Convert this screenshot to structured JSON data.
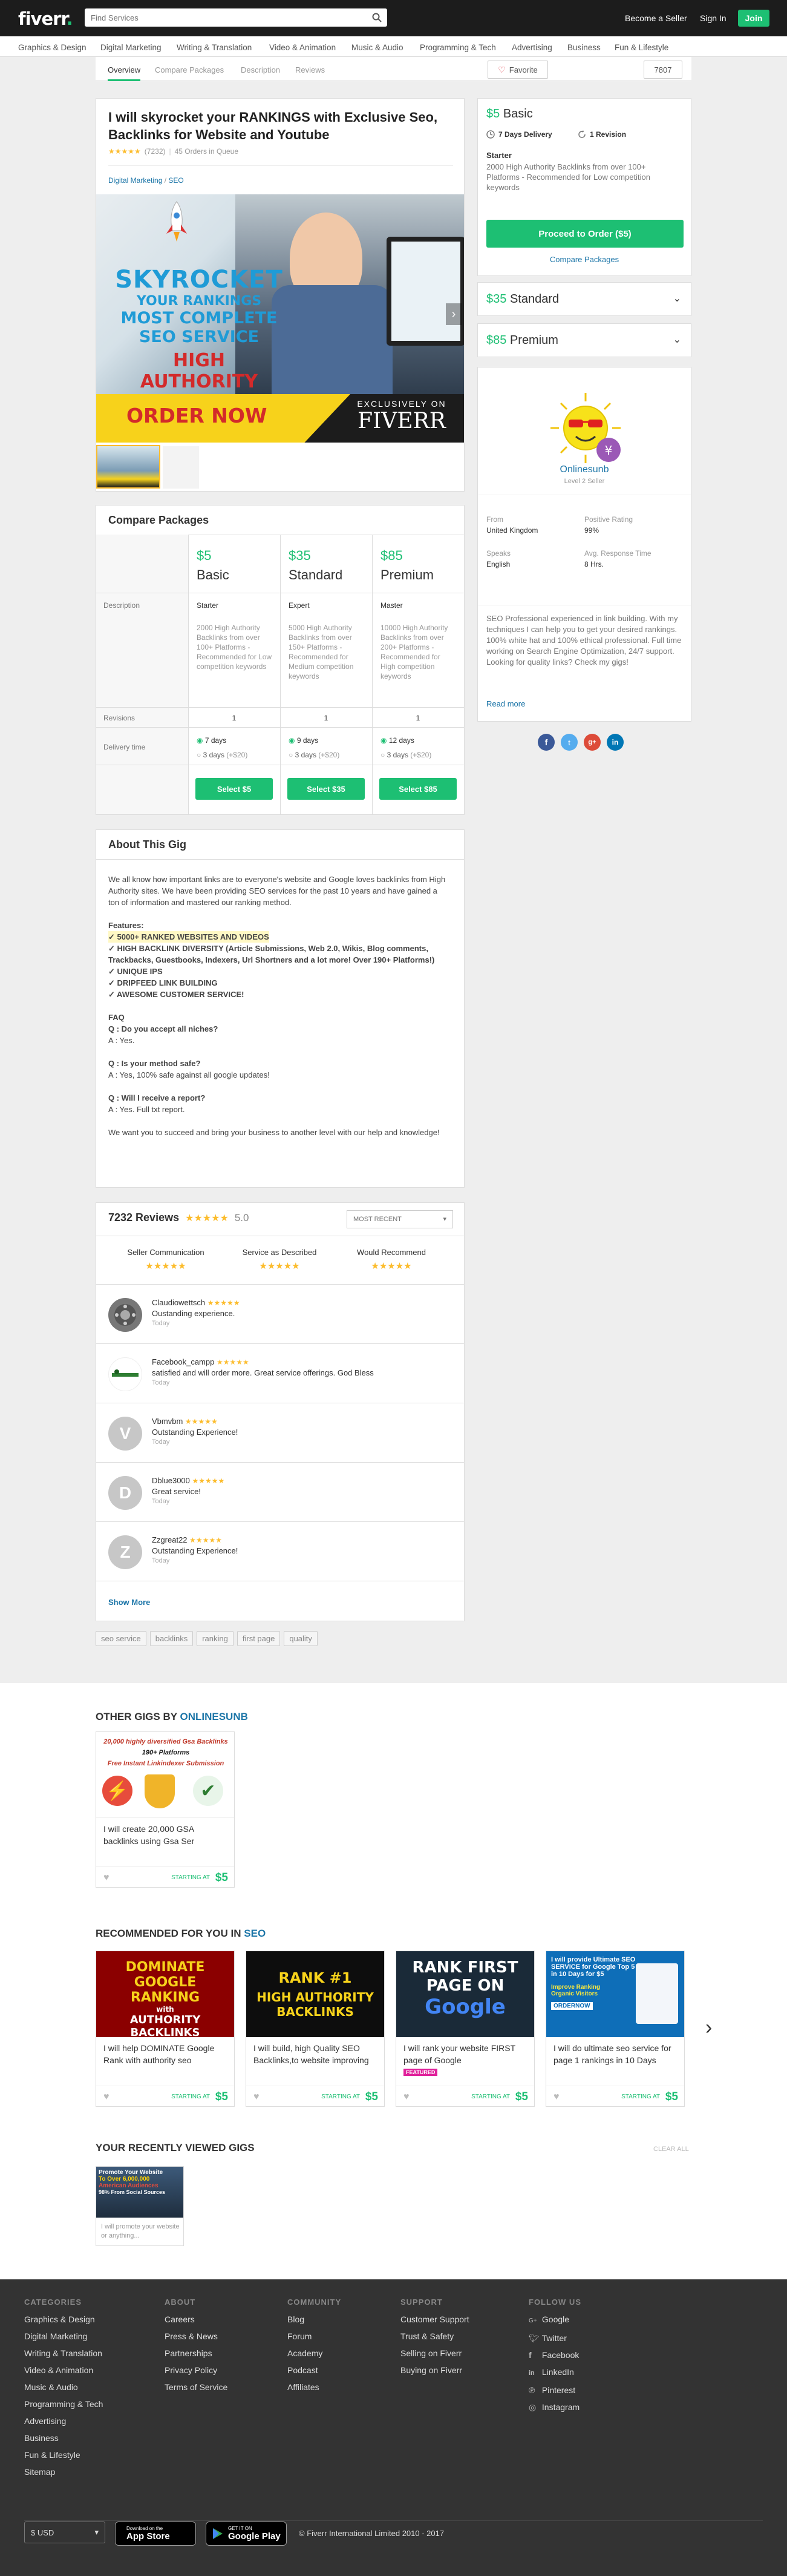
{
  "header": {
    "logo": "fiverr",
    "search_placeholder": "Find Services",
    "become_seller": "Become a Seller",
    "sign_in": "Sign In",
    "join": "Join",
    "categories": [
      "Graphics & Design",
      "Digital Marketing",
      "Writing & Translation",
      "Video & Animation",
      "Music & Audio",
      "Programming & Tech",
      "Advertising",
      "Business",
      "Fun & Lifestyle"
    ]
  },
  "tabs": [
    "Overview",
    "Compare Packages",
    "Description",
    "Reviews"
  ],
  "favorite_label": "Favorite",
  "favorite_count": "7807",
  "gig": {
    "title": "I will skyrocket your RANKINGS with Exclusive Seo, Backlinks for Website and Youtube",
    "rating_count": "(7232)",
    "orders_in_queue": "45 Orders in Queue",
    "breadcrumb_cat": "Digital Marketing",
    "breadcrumb_sep": "/",
    "breadcrumb_sub": "SEO",
    "image": {
      "line1": "SKYROCKET",
      "line2": "YOUR RANKINGS",
      "line3": "MOST COMPLETE",
      "line4": "SEO SERVICE",
      "line5": "HIGH",
      "line6": "AUTHORITY",
      "cta": "ORDER NOW",
      "exclusive": "EXCLUSIVELY ON",
      "brand": "FIVERR"
    }
  },
  "compare": {
    "title": "Compare Packages",
    "row_description": "Description",
    "row_revisions": "Revisions",
    "row_delivery": "Delivery time",
    "packages": [
      {
        "price": "$5",
        "name": "Basic",
        "tier": "Starter",
        "desc": "2000 High Authority Backlinks from over 100+ Platforms - Recommended for Low competition keywords",
        "revisions": "1",
        "delivery": "7 days",
        "fast": "3 days",
        "fast_extra": "(+$20)",
        "btn": "Select $5"
      },
      {
        "price": "$35",
        "name": "Standard",
        "tier": "Expert",
        "desc": "5000 High Authority Backlinks from over 150+ Platforms - Recommended for Medium competition keywords",
        "revisions": "1",
        "delivery": "9 days",
        "fast": "3 days",
        "fast_extra": "(+$20)",
        "btn": "Select $35"
      },
      {
        "price": "$85",
        "name": "Premium",
        "tier": "Master",
        "desc": "10000 High Authority Backlinks from over 200+ Platforms - Recommended for High competition keywords",
        "revisions": "1",
        "delivery": "12 days",
        "fast": "3 days",
        "fast_extra": "(+$20)",
        "btn": "Select $85"
      }
    ]
  },
  "about": {
    "title": "About This Gig",
    "intro": "We all know how important links are to everyone's website and Google loves backlinks from High Authority sites. We have been providing SEO services for the past 10 years and have gained a ton of information and mastered our ranking method.",
    "features_label": "Features:",
    "f1": "✓ 5000+ RANKED WEBSITES AND VIDEOS",
    "f2": "✓ HIGH BACKLINK DIVERSITY (Article Submissions, Web 2.0, Wikis, Blog comments, Trackbacks, Guestbooks, Indexers, Url Shortners and a lot more! Over 190+ Platforms!)",
    "f3": "✓ UNIQUE IPS",
    "f4": "✓ DRIPFEED LINK BUILDING",
    "f5": "✓ AWESOME CUSTOMER SERVICE!",
    "faq": "FAQ",
    "q1": "Q : Do you accept all niches?",
    "a1": "A : Yes.",
    "q2": "Q : Is your method safe?",
    "a2": "A : Yes, 100% safe against all google updates!",
    "q3": "Q : Will I receive a report?",
    "a3": "A : Yes. Full txt report.",
    "outro": "We want you to succeed and bring your business to another level with our help and knowledge!"
  },
  "reviews": {
    "title": "7232 Reviews",
    "score": "5.0",
    "sort": "MOST RECENT",
    "cat1": "Seller Communication",
    "cat2": "Service as Described",
    "cat3": "Would Recommend",
    "items": [
      {
        "name": "Claudiowettsch",
        "text": "Oustanding experience.",
        "time": "Today",
        "initial": ""
      },
      {
        "name": "Facebook_campp",
        "text": "satisfied and will order more. Great service offerings. God Bless",
        "time": "Today",
        "initial": ""
      },
      {
        "name": "Vbmvbm",
        "text": "Outstanding Experience!",
        "time": "Today",
        "initial": "V"
      },
      {
        "name": "Dblue3000",
        "text": "Great service!",
        "time": "Today",
        "initial": "D"
      },
      {
        "name": "Zzgreat22",
        "text": "Outstanding Experience!",
        "time": "Today",
        "initial": "Z"
      }
    ],
    "show_more": "Show More"
  },
  "tags": [
    "seo service",
    "backlinks",
    "ranking",
    "first page",
    "quality"
  ],
  "order_box": {
    "price": "$5",
    "package": "Basic",
    "delivery": "7 Days Delivery",
    "revision": "1 Revision",
    "tier": "Starter",
    "desc": "2000 High Authority Backlinks from over 100+ Platforms - Recommended for Low competition keywords",
    "order_btn": "Proceed to Order ($5)",
    "compare_link": "Compare Packages",
    "standard_price": "$35",
    "standard_name": "Standard",
    "premium_price": "$85",
    "premium_name": "Premium"
  },
  "seller": {
    "name": "Onlinesunb",
    "level": "Level 2 Seller",
    "from_label": "From",
    "from": "United Kingdom",
    "rating_label": "Positive Rating",
    "rating": "99%",
    "speaks_label": "Speaks",
    "speaks": "English",
    "response_label": "Avg. Response Time",
    "response": "8 Hrs.",
    "bio": "SEO Professional experienced in link building. With my techniques I can help you to get your desired rankings. 100% white hat and 100% ethical professional. Full time working on Search Engine Optimization, 24/7 support. Looking for quality links? Check my gigs!",
    "read_more": "Read more"
  },
  "other_gigs": {
    "title_prefix": "OTHER GIGS BY",
    "title_user": "ONLINESUNB",
    "gig": {
      "img1": "20,000 highly diversified Gsa Backlinks",
      "img2": "190+ Platforms",
      "img3": "Free Instant Linkindexer Submission",
      "text": "I will create 20,000 GSA backlinks using Gsa Ser",
      "starting": "STARTING AT",
      "price": "$5"
    }
  },
  "recommended": {
    "title_prefix": "RECOMMENDED FOR YOU IN",
    "title_cat": "SEO",
    "gigs": [
      {
        "l1": "DOMINATE",
        "l2": "GOOGLE",
        "l3": "RANKING",
        "l4": "with",
        "l5": "AUTHORITY",
        "l6": "BACKLINKS",
        "text": "I will help DOMINATE Google Rank with authority seo",
        "starting": "STARTING AT",
        "price": "$5",
        "featured": ""
      },
      {
        "l1": "RANK #1",
        "l2": "HIGH AUTHORITY",
        "l3": "BACKLINKS",
        "text": "I will build, high Quality SEO Backlinks,to website improving",
        "starting": "STARTING AT",
        "price": "$5",
        "featured": ""
      },
      {
        "l1": "RANK FIRST",
        "l2": "PAGE ON",
        "l3": "Google",
        "text": "I will rank your website FIRST page of Google",
        "starting": "STARTING AT",
        "price": "$5",
        "featured": "FEATURED"
      },
      {
        "l1": "I will provide Ultimate SEO SERVICE for Google Top 5 in 10 Days for $5",
        "l2": "Improve Ranking",
        "l3": "Organic Visitors",
        "l4": "ORDERNOW",
        "text": "I will do ultimate seo service for page 1 rankings in 10 Days",
        "starting": "STARTING AT",
        "price": "$5",
        "featured": ""
      }
    ]
  },
  "recent": {
    "title": "YOUR RECENTLY VIEWED GIGS",
    "clear": "CLEAR ALL",
    "img1": "Promote Your Website",
    "img2": "To Over 6,000,000",
    "img3": "American Audiences",
    "img4": "98% From Social Sources",
    "text": "I will promote your website or anything..."
  },
  "footer": {
    "categories_title": "CATEGORIES",
    "categories": [
      "Graphics & Design",
      "Digital Marketing",
      "Writing & Translation",
      "Video & Animation",
      "Music & Audio",
      "Programming & Tech",
      "Advertising",
      "Business",
      "Fun & Lifestyle",
      "Sitemap"
    ],
    "about_title": "ABOUT",
    "about": [
      "Careers",
      "Press & News",
      "Partnerships",
      "Privacy Policy",
      "Terms of Service"
    ],
    "community_title": "COMMUNITY",
    "community": [
      "Blog",
      "Forum",
      "Academy",
      "Podcast",
      "Affiliates"
    ],
    "support_title": "SUPPORT",
    "support": [
      "Customer Support",
      "Trust & Safety",
      "Selling on Fiverr",
      "Buying on Fiverr"
    ],
    "follow_title": "FOLLOW US",
    "follow": [
      "Google",
      "Twitter",
      "Facebook",
      "LinkedIn",
      "Pinterest",
      "Instagram"
    ],
    "currency": "$ USD",
    "appstore_small": "Download on the",
    "appstore": "App Store",
    "googleplay_small": "GET IT ON",
    "googleplay": "Google Play",
    "copyright": "© Fiverr International Limited 2010 - 2017"
  },
  "colors": {
    "brand": "#1dbf73",
    "star": "#fcbc2c",
    "link": "#1d76a8"
  }
}
